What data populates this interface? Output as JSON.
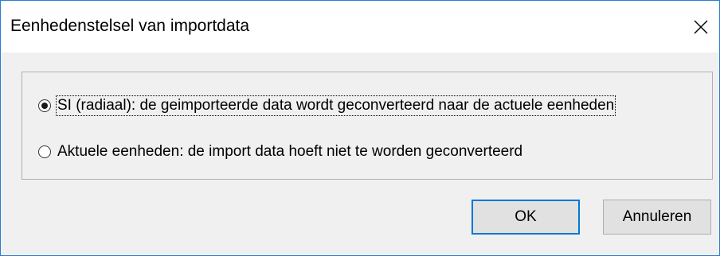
{
  "dialog": {
    "title": "Eenhedenstelsel van importdata",
    "close_icon": "close-icon"
  },
  "options": [
    {
      "label": "SI (radiaal): de geimporteerde data wordt geconverteerd naar de actuele eenheden",
      "selected": true
    },
    {
      "label": "Aktuele eenheden: de import data hoeft niet te worden geconverteerd",
      "selected": false
    }
  ],
  "buttons": {
    "ok_label": "OK",
    "cancel_label": "Annuleren"
  },
  "colors": {
    "accent": "#0078d7",
    "window_border": "#2b7bd6",
    "background": "#f0f0f0"
  }
}
